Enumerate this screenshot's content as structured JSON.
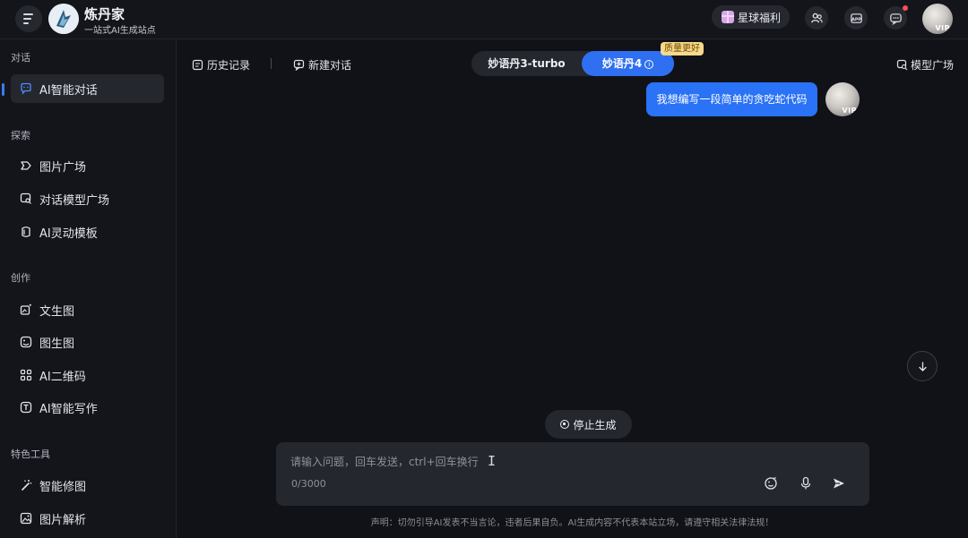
{
  "header": {
    "brand_title": "炼丹家",
    "brand_subtitle": "一站式AI生成站点",
    "welfare_label": "星球福利",
    "avatar_badge": "VIP"
  },
  "sidebar": {
    "sections": [
      {
        "title": "对话",
        "items": [
          {
            "label": "AI智能对话",
            "icon": "chat-bubble-icon",
            "active": true
          }
        ]
      },
      {
        "title": "探索",
        "items": [
          {
            "label": "图片广场",
            "icon": "tag-icon"
          },
          {
            "label": "对话模型广场",
            "icon": "model-search-icon"
          },
          {
            "label": "AI灵动模板",
            "icon": "template-icon"
          }
        ]
      },
      {
        "title": "创作",
        "items": [
          {
            "label": "文生图",
            "icon": "text-to-image-icon"
          },
          {
            "label": "图生图",
            "icon": "image-to-image-icon"
          },
          {
            "label": "AI二维码",
            "icon": "qrcode-icon"
          },
          {
            "label": "AI智能写作",
            "icon": "text-box-icon"
          }
        ]
      },
      {
        "title": "特色工具",
        "items": [
          {
            "label": "智能修图",
            "icon": "magic-wand-icon"
          },
          {
            "label": "图片解析",
            "icon": "image-parse-icon"
          }
        ]
      }
    ]
  },
  "toolbar": {
    "history_label": "历史记录",
    "new_chat_label": "新建对话",
    "models": [
      {
        "label": "妙语丹3-turbo",
        "selected": false
      },
      {
        "label": "妙语丹4",
        "selected": true
      }
    ],
    "quality_badge": "质量更好",
    "model_plaza_label": "模型广场"
  },
  "chat": {
    "messages": [
      {
        "role": "user",
        "text": "我想编写一段简单的贪吃蛇代码",
        "avatar_badge": "VIP"
      }
    ],
    "stop_label": "停止生成"
  },
  "composer": {
    "placeholder": "请输入问题，回车发送，ctrl+回车换行",
    "value": "",
    "counter": "0/3000"
  },
  "footer": {
    "disclaimer": "声明：切勿引导AI发表不当言论，违者后果自负。AI生成内容不代表本站立场，请遵守相关法律法规！"
  },
  "colors": {
    "accent": "#2f6ff1",
    "background": "#111218",
    "panel": "#25272e"
  }
}
